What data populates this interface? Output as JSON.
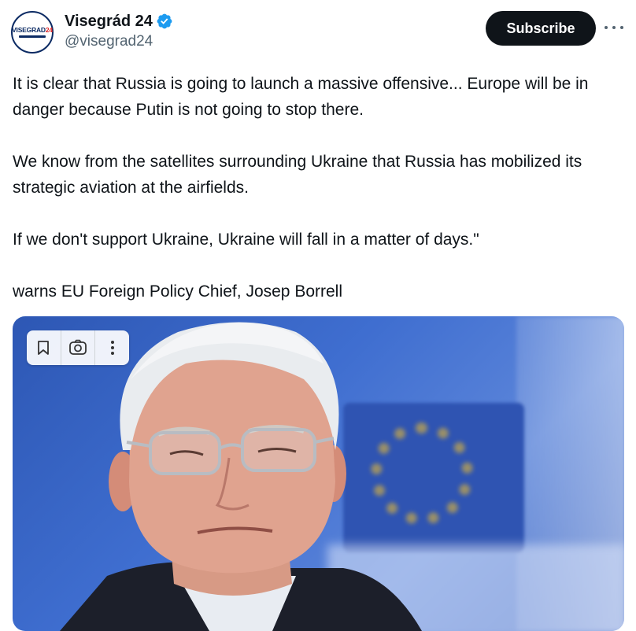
{
  "account": {
    "display_name": "Visegrád 24",
    "handle": "@visegrad24",
    "avatar_text_a": "VISEGRAD",
    "avatar_text_b": "24",
    "verified_color": "#1d9bf0"
  },
  "actions": {
    "subscribe_label": "Subscribe",
    "more_icon": "more-horizontal-icon"
  },
  "tweet": {
    "paragraphs": [
      "It is clear that Russia is going to launch a massive offensive... Europe will be in danger because Putin is not going to stop there.",
      "We know from the satellites surrounding Ukraine that Russia has mobilized its strategic aviation at the airfields.",
      "If we don't support Ukraine, Ukraine will fall in a matter of days.\"",
      "warns EU Foreign Policy Chief, Josep Borrell"
    ]
  },
  "media": {
    "toolbar_icons": [
      "bookmark-icon",
      "lens-search-icon",
      "more-vertical-icon"
    ]
  },
  "colors": {
    "text": "#0f1419",
    "secondary": "#536471",
    "button_bg": "#0f1419"
  }
}
